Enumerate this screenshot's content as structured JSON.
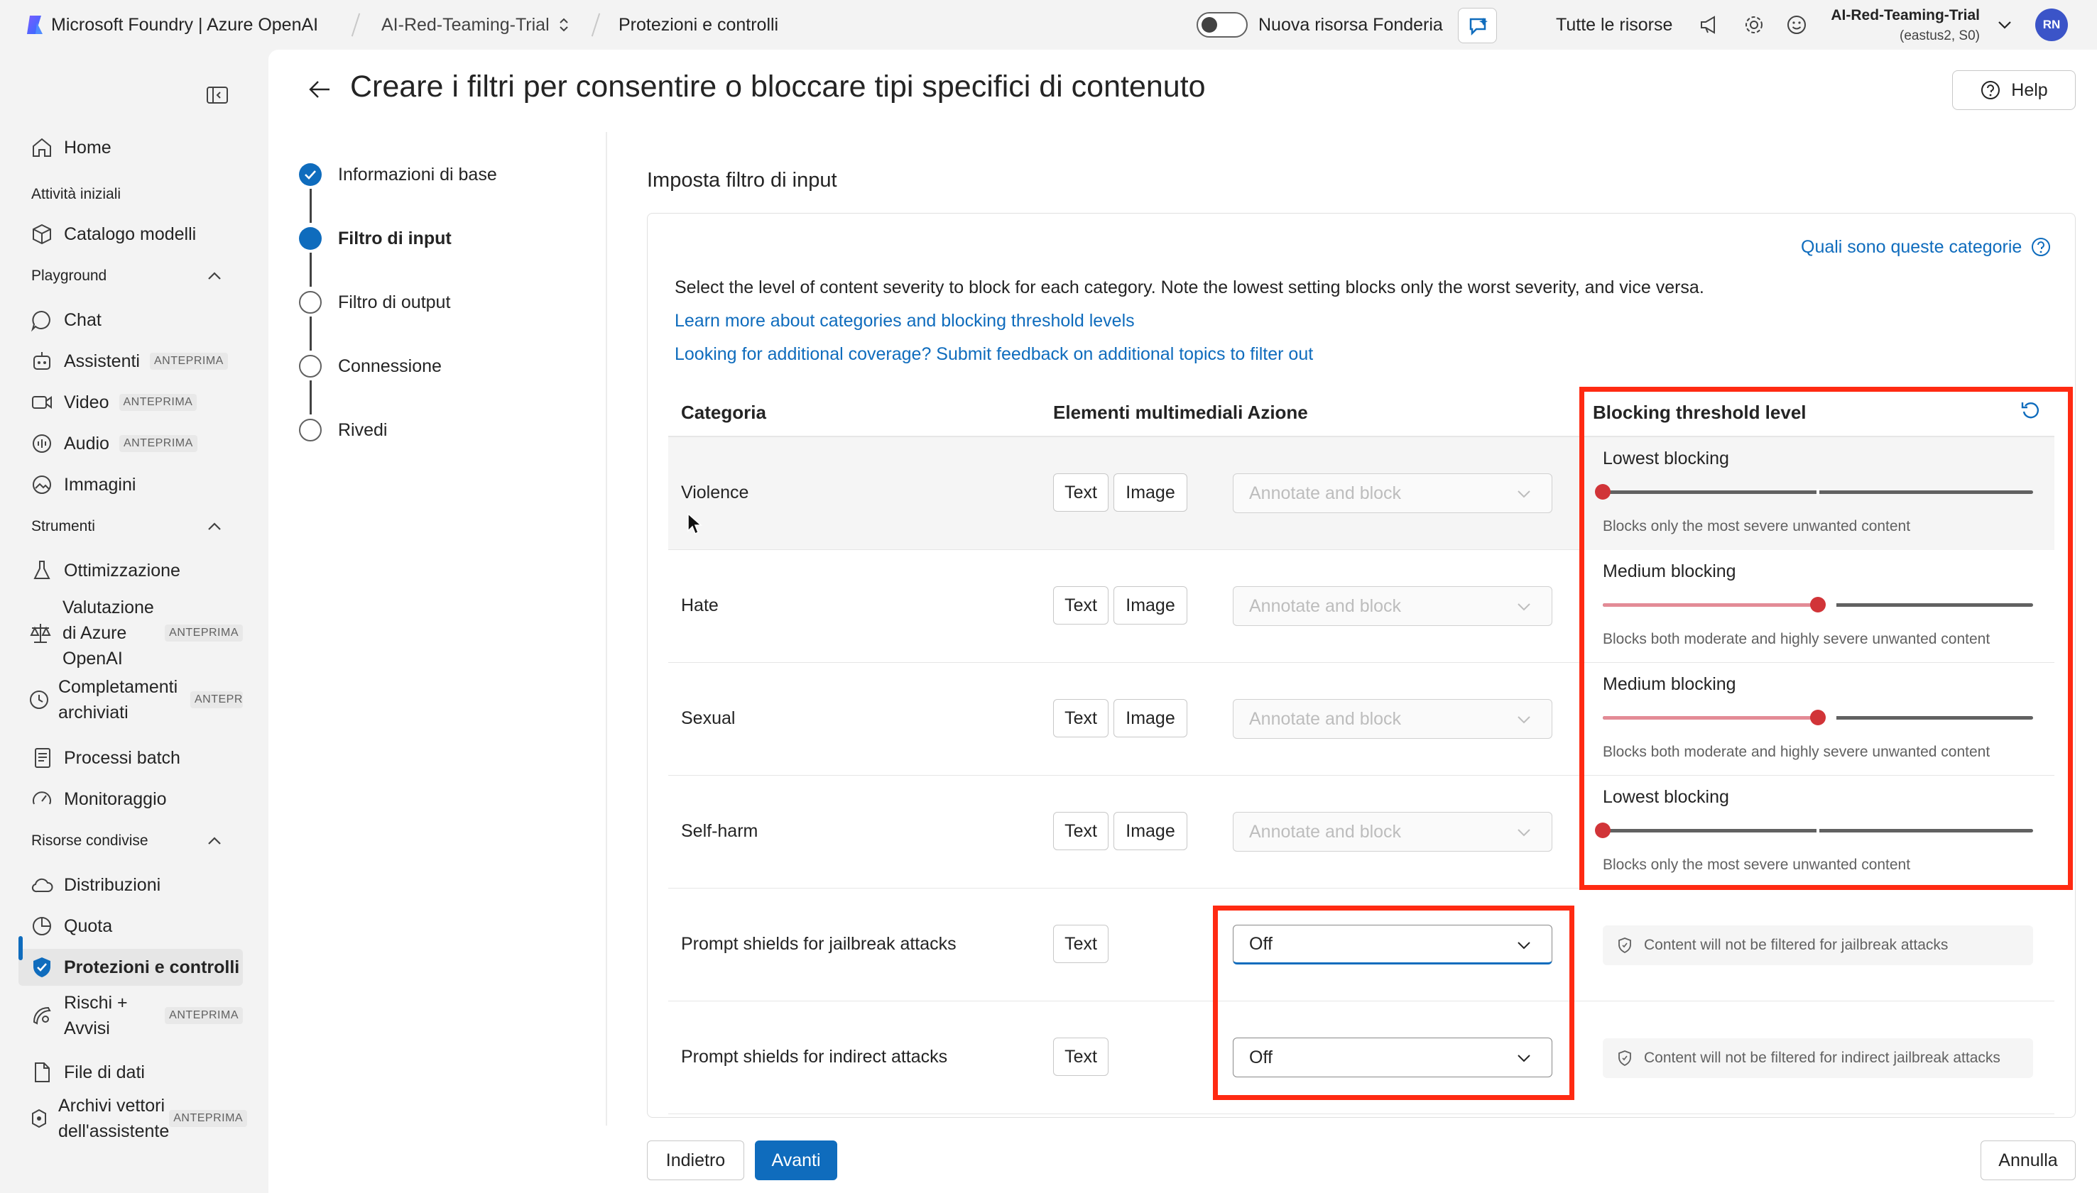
{
  "topbar": {
    "brand": "Microsoft Foundry | Azure OpenAI",
    "project": "AI-Red-Teaming-Trial",
    "page": "Protezioni e controlli",
    "toggle_label": "Nuova risorsa Fonderia",
    "toggle_on": false,
    "all_resources": "Tutte le risorse",
    "account_name": "AI-Red-Teaming-Trial",
    "account_region": "(eastus2, S0)",
    "avatar_initials": "RN"
  },
  "sidebar": {
    "home": "Home",
    "section_getting_started": "Attività iniziali",
    "model_catalog": "Catalogo modelli",
    "section_playground": "Playground",
    "chat": "Chat",
    "assistants": "Assistenti",
    "video": "Video",
    "audio": "Audio",
    "images": "Immagini",
    "section_tools": "Strumenti",
    "optimization": "Ottimizzazione",
    "evaluation": "Valutazione di Azure OpenAI",
    "stored_completions": "Completamenti archiviati",
    "batch_jobs": "Processi batch",
    "monitoring": "Monitoraggio",
    "section_shared": "Risorse condivise",
    "deployments": "Distribuzioni",
    "quota": "Quota",
    "guardrails": "Protezioni e controlli",
    "risks": "Rischi + Avvisi",
    "data_files": "File di dati",
    "vector_stores": "Archivi vettori dell'assistente",
    "preview_badge": "ANTEPRIMA",
    "preview_badge_cut": "ANTEPRIM"
  },
  "page": {
    "title": "Creare i filtri per consentire o bloccare tipi specifici di contenuto",
    "help": "Help"
  },
  "stepper": [
    {
      "label": "Informazioni di base",
      "state": "done"
    },
    {
      "label": "Filtro di input",
      "state": "current"
    },
    {
      "label": "Filtro di output",
      "state": "todo"
    },
    {
      "label": "Connessione",
      "state": "todo"
    },
    {
      "label": "Rivedi",
      "state": "todo"
    }
  ],
  "filter": {
    "section_title": "Imposta filtro di input",
    "what_categories": "Quali sono queste categorie",
    "description": "Select the level of content severity to block for each category. Note the lowest setting blocks only the worst severity, and vice versa.",
    "learn_more": "Learn more about categories and blocking threshold levels",
    "feedback": "Looking for additional coverage? Submit feedback on additional topics to filter out",
    "headers": {
      "category": "Categoria",
      "media_action": "Elementi multimediali Azione",
      "threshold": "Blocking threshold level"
    },
    "media_text": "Text",
    "media_image": "Image",
    "rows": [
      {
        "category": "Violence",
        "action": "Annotate and block",
        "level": "Lowest blocking",
        "level_desc": "Blocks only the most severe unwanted content",
        "level_value": 0
      },
      {
        "category": "Hate",
        "action": "Annotate and block",
        "level": "Medium blocking",
        "level_desc": "Blocks both moderate and highly severe unwanted content",
        "level_value": 0.5
      },
      {
        "category": "Sexual",
        "action": "Annotate and block",
        "level": "Medium blocking",
        "level_desc": "Blocks both moderate and highly severe unwanted content",
        "level_value": 0.5
      },
      {
        "category": "Self-harm",
        "action": "Annotate and block",
        "level": "Lowest blocking",
        "level_desc": "Blocks only the most severe unwanted content",
        "level_value": 0
      }
    ],
    "shields": [
      {
        "category": "Prompt shields for jailbreak attacks",
        "value": "Off",
        "info": "Content will not be filtered for jailbreak attacks"
      },
      {
        "category": "Prompt shields for indirect attacks",
        "value": "Off",
        "info": "Content will not be filtered for indirect jailbreak attacks"
      }
    ]
  },
  "footer": {
    "back": "Indietro",
    "next": "Avanti",
    "cancel": "Annulla"
  },
  "colors": {
    "accent": "#0f6cbd",
    "highlight": "#ff2a12",
    "slider_knob": "#d13438"
  }
}
